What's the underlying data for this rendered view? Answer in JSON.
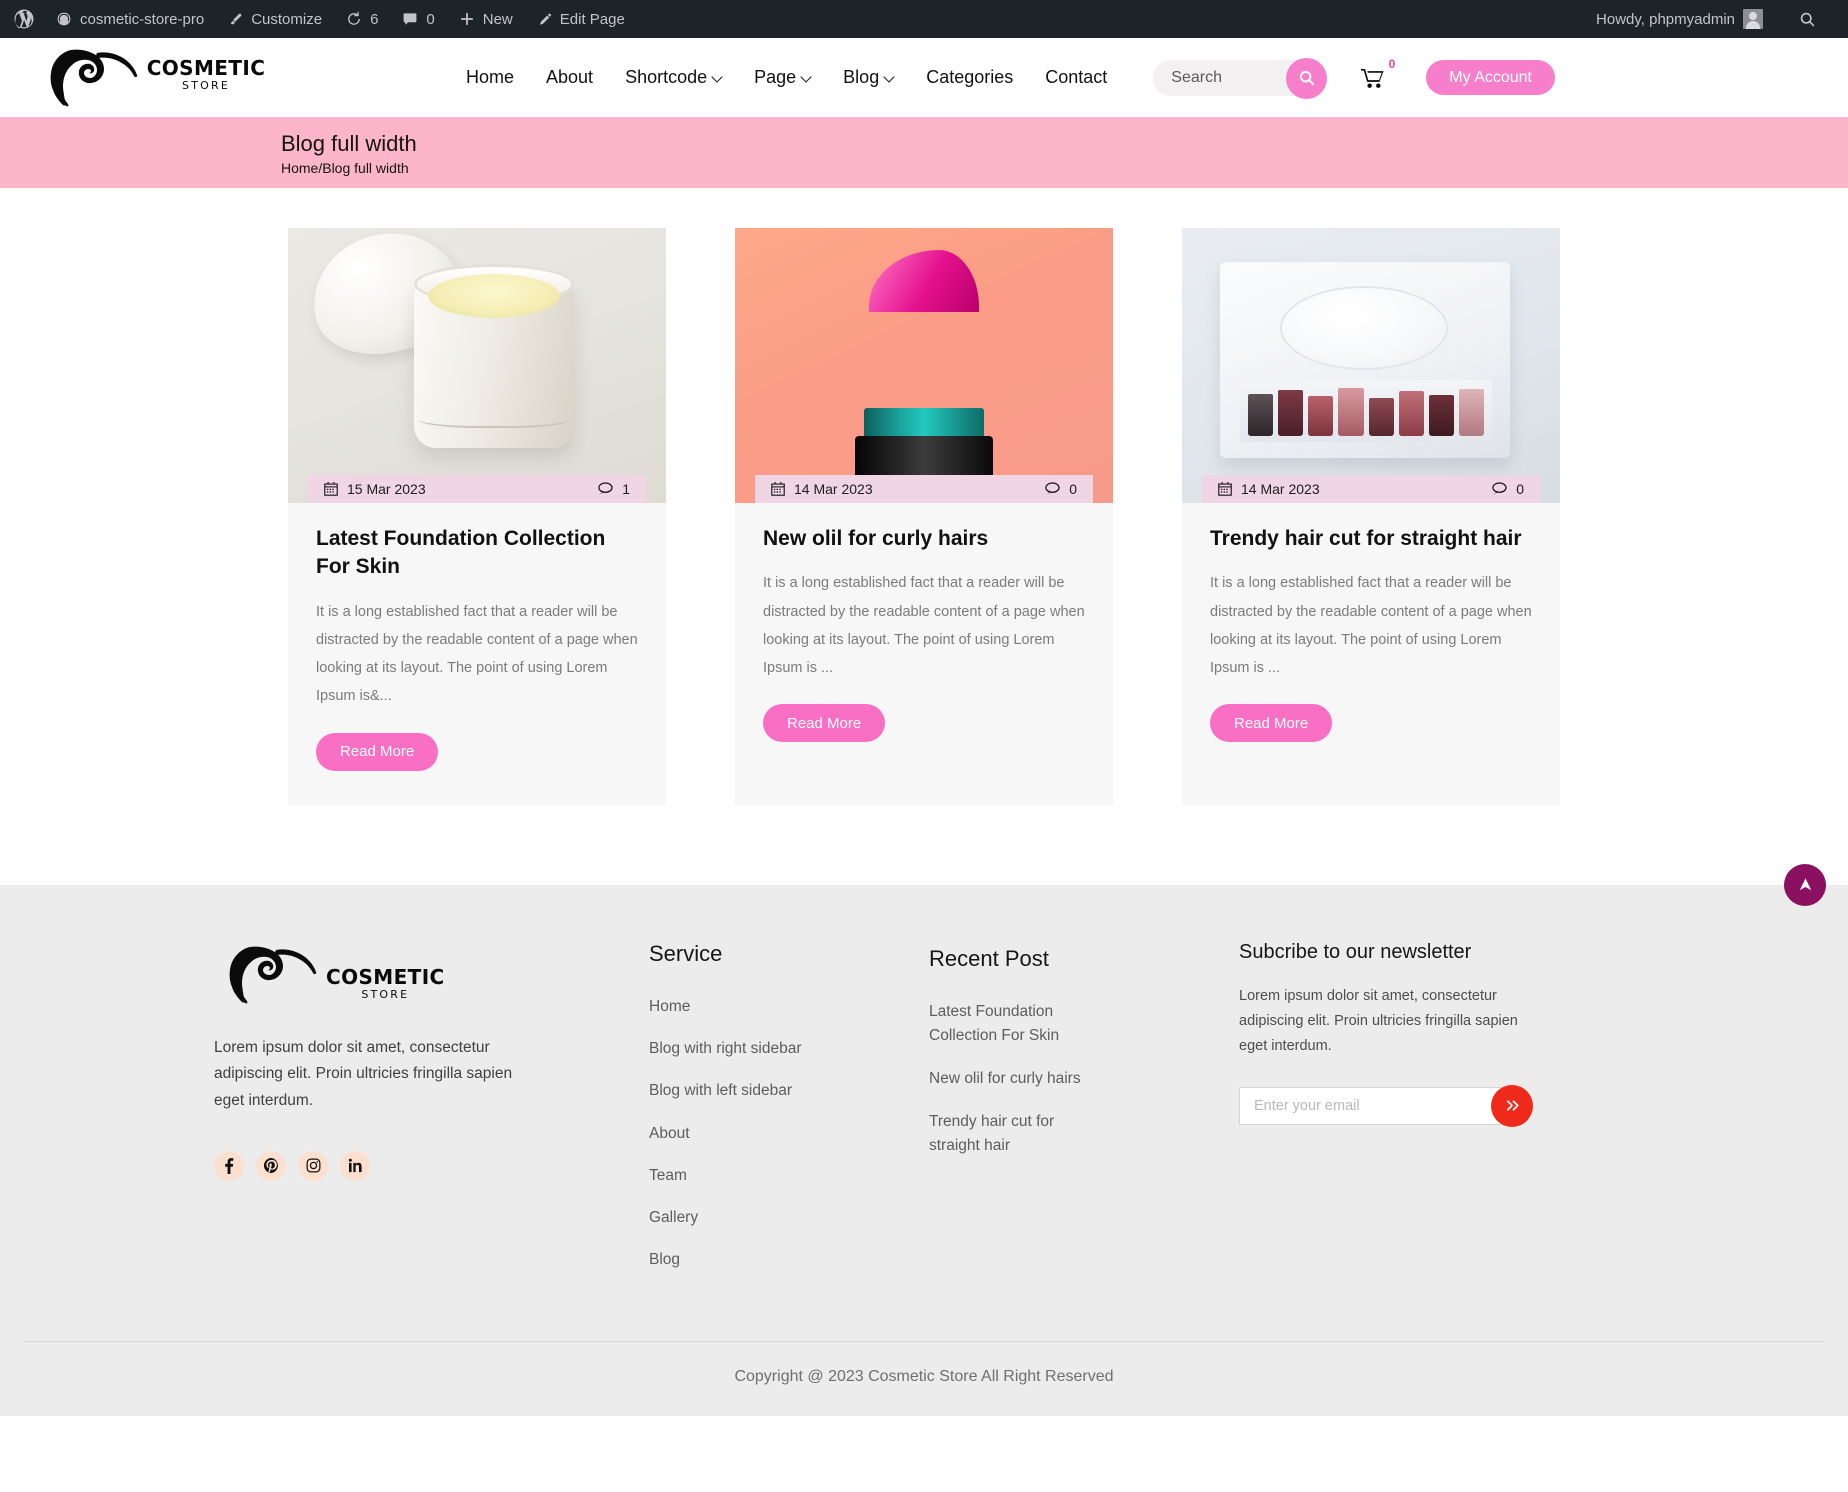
{
  "adminbar": {
    "wp_logo": "wordpress-logo-icon",
    "site_name": "cosmetic-store-pro",
    "customize": "Customize",
    "updates_count": "6",
    "comments_count": "0",
    "new": "New",
    "edit_page": "Edit Page",
    "howdy": "Howdy, phpmyadmin",
    "search_icon": "search-icon"
  },
  "header": {
    "logo_main": "COSMETIC",
    "logo_sub": "STORE",
    "nav": [
      {
        "label": "Home",
        "has_caret": false
      },
      {
        "label": "About",
        "has_caret": false
      },
      {
        "label": "Shortcode",
        "has_caret": true
      },
      {
        "label": "Page",
        "has_caret": true
      },
      {
        "label": "Blog",
        "has_caret": true
      },
      {
        "label": "Categories",
        "has_caret": false
      },
      {
        "label": "Contact",
        "has_caret": false
      }
    ],
    "search_placeholder": "Search",
    "search_value": "",
    "cart_count": "0",
    "account_label": "My Account",
    "accent": "#f77ecb"
  },
  "banner": {
    "title": "Blog full width",
    "breadcrumb": "Home/Blog full width",
    "bg": "#fdb5cb"
  },
  "posts": [
    {
      "thumb": "cream-jar-image",
      "date": "15 Mar 2023",
      "comments": "1",
      "title": "Latest Foundation Collection For Skin",
      "excerpt": "It is a long established fact that a reader will be distracted by the readable content of a page when looking at its layout. The point of using Lorem Ipsum is&...",
      "read_more": "Read More"
    },
    {
      "thumb": "lipstick-image",
      "date": "14 Mar 2023",
      "comments": "0",
      "title": "New olil for curly hairs",
      "excerpt": "It is a long established fact that a reader will be distracted by the readable content of a page when looking at its layout. The point of using Lorem Ipsum is ...",
      "read_more": "Read More"
    },
    {
      "thumb": "makeup-palette-image",
      "date": "14 Mar 2023",
      "comments": "0",
      "title": "Trendy hair cut for straight hair",
      "excerpt": "It is a long established fact that a reader will be distracted by the readable content of a page when looking at its layout. The point of using Lorem Ipsum is ...",
      "read_more": "Read More"
    }
  ],
  "scroll_top": {
    "icon": "arrow-up-icon",
    "color": "#8c1060"
  },
  "footer": {
    "logo_main": "COSMETIC",
    "logo_sub": "STORE",
    "description": "Lorem ipsum dolor sit amet, consectetur adipiscing elit. Proin ultricies fringilla sapien eget interdum.",
    "socials": [
      "facebook-icon",
      "pinterest-icon",
      "instagram-icon",
      "linkedin-icon"
    ],
    "service": {
      "title": "Service",
      "links": [
        "Home",
        "Blog with right sidebar",
        "Blog with left sidebar",
        "About",
        "Team",
        "Gallery",
        "Blog"
      ]
    },
    "recent": {
      "title": "Recent Post",
      "posts": [
        "Latest Foundation Collection For Skin",
        "New olil for curly hairs",
        "Trendy hair cut for straight hair"
      ]
    },
    "newsletter": {
      "title": "Subcribe to our newsletter",
      "description": "Lorem ipsum dolor sit amet, consectetur adipiscing elit. Proin ultricies fringilla sapien eget interdum.",
      "placeholder": "Enter your email",
      "value": "",
      "submit_icon": "double-chevron-right-icon",
      "submit_color": "#ef2a1a"
    },
    "copyright": "Copyright @ 2023 Cosmetic Store All Right Reserved"
  }
}
